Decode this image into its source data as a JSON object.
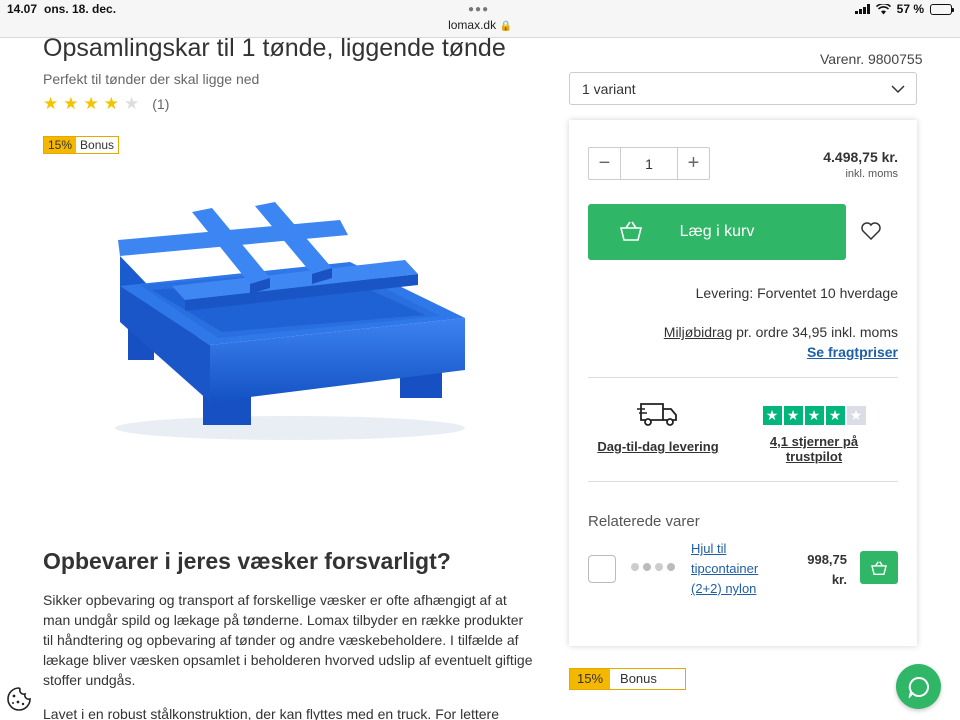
{
  "status_bar": {
    "time": "14.07",
    "date": "ons. 18. dec.",
    "url": "lomax.dk",
    "battery": "57 %",
    "battery_level": 0.57
  },
  "product": {
    "title": "Opsamlingskar til 1 tønde, liggende tønde",
    "subtitle": "Perfekt til tønder der skal ligge ned",
    "rating_stars": 4,
    "rating_max": 5,
    "rating_count": "(1)",
    "bonus_pct": "15%",
    "bonus_label": "Bonus",
    "sku": "Varenr. 9800755",
    "image_color": "#1f62d6"
  },
  "variant": {
    "selected": "1 variant"
  },
  "buy_box": {
    "quantity": "1",
    "price": "4.498,75 kr.",
    "price_note": "inkl. moms",
    "cart_button": "Læg i kurv",
    "delivery": "Levering: Forventet 10 hverdage",
    "env_link": "Miljøbidrag",
    "env_text": " pr. ordre 34,95 inkl. moms",
    "freight_link": "Se fragtpriser",
    "day_delivery": "Dag-til-dag levering",
    "trustpilot": "4,1 stjerner på trustpilot",
    "accent_color": "#2fb767",
    "link_color": "#1f5fa8"
  },
  "related": {
    "title": "Relaterede varer",
    "item_name": "Hjul til tipcontainer (2+2) nylon",
    "item_price": "998,75 kr."
  },
  "bottom_bonus": {
    "pct": "15%",
    "label": "Bonus"
  },
  "article": {
    "heading": "Opbevarer i jeres væsker forsvarligt?",
    "paragraph1": "Sikker opbevaring og transport af forskellige væsker er ofte afhængigt af at man undgår spild og lækage på tønderne. Lomax tilbyder en række produkter til håndtering og opbevaring af tønder og andre væskebeholdere. I tilfælde af lækage bliver væsken opsamlet i beholderen hvorved udslip af eventuelt giftige stoffer undgås.",
    "paragraph2": "Lavet i en robust stålkonstruktion, der kan flyttes med en truck. For lettere"
  }
}
